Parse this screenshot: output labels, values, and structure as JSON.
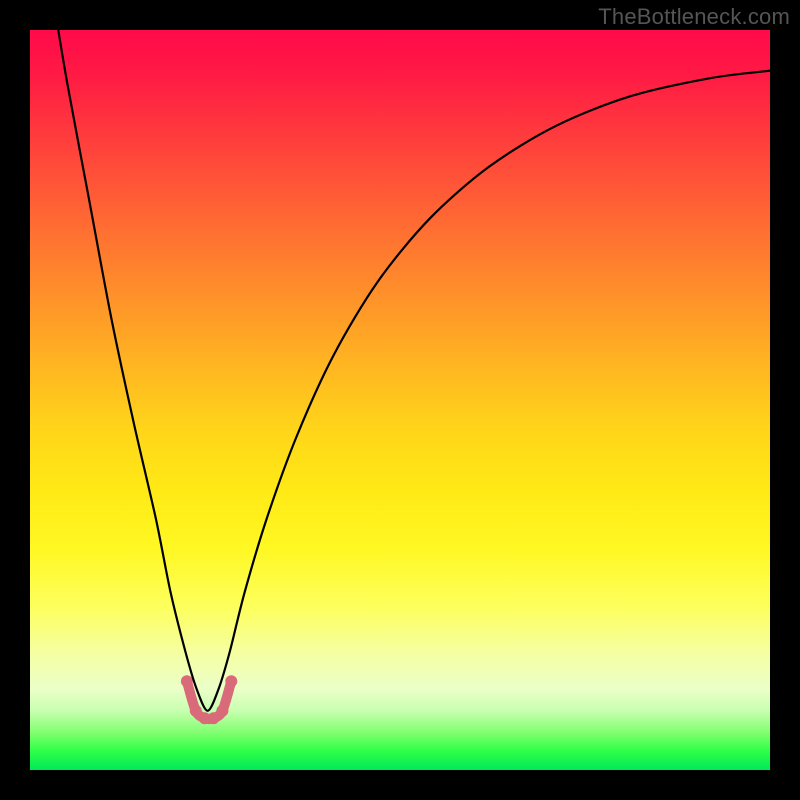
{
  "watermark": "TheBottleneck.com",
  "chart_data": {
    "type": "line",
    "title": "",
    "xlabel": "",
    "ylabel": "",
    "xlim": [
      0,
      100
    ],
    "ylim": [
      0,
      100
    ],
    "grid": false,
    "series": [
      {
        "name": "bottleneck-curve",
        "x_percent": [
          3,
          5,
          8,
          11,
          14,
          17,
          19,
          21,
          22.5,
          24,
          25.5,
          27,
          29,
          32,
          36,
          41,
          47,
          54,
          62,
          71,
          81,
          92,
          100
        ],
        "y_percent": [
          -5,
          7,
          23,
          39,
          53,
          66,
          76,
          84,
          89,
          92,
          89,
          84,
          76,
          66,
          55,
          44,
          34,
          25.5,
          18.5,
          13,
          9,
          6.5,
          5.5
        ],
        "comment": "y_percent = 100 means bottom edge (green), 0 means top edge (red); values <0 extend above the visible plot",
        "stroke": "#000000",
        "stroke_width": 2.2
      },
      {
        "name": "trough-marker",
        "marker_x_percent": [
          21.2,
          22.4,
          23.6,
          24.8,
          26.0,
          27.2
        ],
        "marker_y_percent": [
          88,
          92,
          93,
          93,
          92,
          88
        ],
        "stroke": "#d96a7a",
        "stroke_width": 10,
        "marker_radius": 6
      }
    ],
    "gradient_meaning": "top (red) = high bottleneck, bottom (green) = low bottleneck"
  },
  "colors": {
    "frame": "#000000",
    "watermark": "#555555",
    "curve": "#000000",
    "trough": "#d96a7a"
  }
}
